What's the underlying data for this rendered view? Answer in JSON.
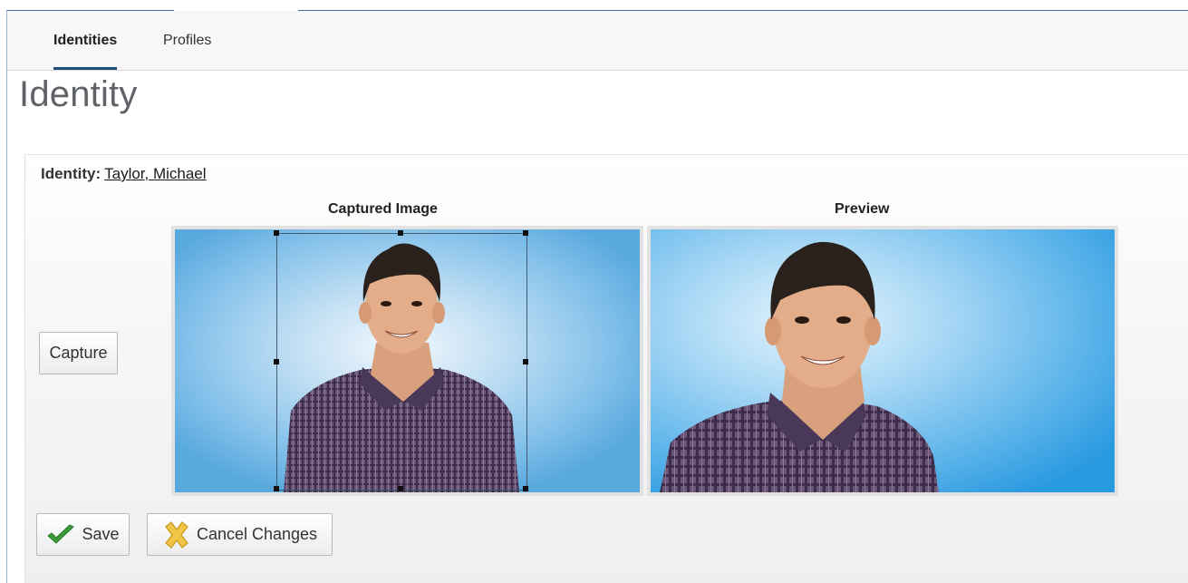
{
  "tabs": [
    {
      "label": "Identities",
      "active": true
    },
    {
      "label": "Profiles",
      "active": false
    }
  ],
  "page": {
    "title": "Identity"
  },
  "identity": {
    "label": "Identity:",
    "name": "Taylor, Michael"
  },
  "columns": {
    "captured": "Captured Image",
    "preview": "Preview"
  },
  "buttons": {
    "capture": "Capture",
    "save": "Save",
    "cancel": "Cancel Changes"
  },
  "icons": {
    "save": "checkmark-icon",
    "cancel": "x-icon"
  },
  "colors": {
    "accent": "#1f4e79",
    "photo_bg": "#6fb6e6",
    "shirt": "#5d4868",
    "save_check": "#3a9a3a",
    "cancel_x": "#e8b730"
  }
}
